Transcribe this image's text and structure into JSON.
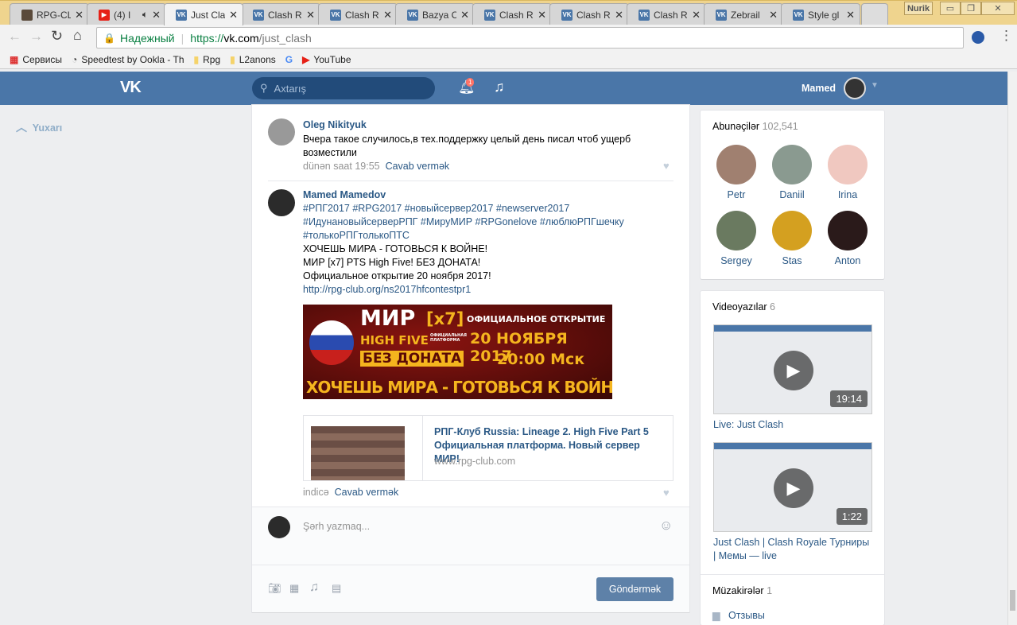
{
  "browser": {
    "tabs": [
      {
        "title": "RPG-CL",
        "icon": "rpg-favicon"
      },
      {
        "title": "(4) I",
        "icon": "youtube-favicon",
        "audio": true
      },
      {
        "title": "Just Cla",
        "icon": "vk-favicon",
        "active": true
      },
      {
        "title": "Clash R",
        "icon": "vk-favicon"
      },
      {
        "title": "Clash R",
        "icon": "vk-favicon"
      },
      {
        "title": "Bazya C",
        "icon": "vk-favicon"
      },
      {
        "title": "Clash R",
        "icon": "vk-favicon"
      },
      {
        "title": "Clash R",
        "icon": "vk-favicon"
      },
      {
        "title": "Clash R",
        "icon": "vk-favicon"
      },
      {
        "title": "Zebrail",
        "icon": "vk-favicon"
      },
      {
        "title": "Style gl",
        "icon": "vk-favicon"
      }
    ],
    "profile_label": "Nurik",
    "secure_label": "Надежный",
    "url_scheme": "https://",
    "url_host": "vk.com",
    "url_path": "/just_clash",
    "bookmarks": [
      {
        "label": "Сервисы",
        "icon": "apps-icon"
      },
      {
        "label": "Speedtest by Ookla - Th",
        "icon": "speedometer-icon"
      },
      {
        "label": "Rpg",
        "icon": "folder-icon"
      },
      {
        "label": "L2anons",
        "icon": "folder-icon"
      },
      {
        "label": "",
        "icon": "google-translate-icon"
      },
      {
        "label": "YouTube",
        "icon": "youtube-icon"
      }
    ]
  },
  "vk": {
    "search_placeholder": "Axtarış",
    "notifications_count": "1",
    "user_name": "Mamed",
    "back_to_top": "Yuxarı",
    "comments": [
      {
        "author": "Oleg Nikityuk",
        "text": "Вчера такое случилось,в тех.поддержку целый день писал чтоб ущерб возместили",
        "time": "dünən saat 19:55",
        "reply": "Cavab vermək"
      },
      {
        "author": "Mamed Mamedov",
        "hashtags": [
          "#РПГ2017 #RPG2017 #новыйсервер2017 #newserver2017",
          "#ИдунановыйсерверРПГ #МируМИР #RPGonelove #люблюРПГшечку",
          "#толькоРПГтолькоПТС"
        ],
        "lines": [
          "ХОЧЕШЬ МИРА - ГОТОВЬСЯ К ВОЙНЕ!",
          "МИР [x7] PTS High Five! БЕЗ ДОНАТА!",
          "Официальное открытие 20 ноября 2017!"
        ],
        "link": "http://rpg-club.org/ns2017hfcontestpr1",
        "banner": {
          "title": "МИР",
          "rate": "[x7]",
          "subtitle": "HIGH FIVE",
          "platform": "ОФИЦИАЛЬНАЯ ПЛАТФОРМА",
          "nodonate": "БЕЗ ДОНАТА",
          "opening": "ОФИЦИАЛЬНОЕ ОТКРЫТИЕ",
          "date": "20 НОЯБРЯ 2017",
          "time": "20:00 Мск",
          "slogan": "ХОЧЕШЬ МИРА - ГОТОВЬСЯ К ВОЙНЕ"
        },
        "snippet": {
          "title": "РПГ-Клуб Russia: Lineage 2. High Five Part 5 Официальная платформа. Новый сервер МИР!",
          "domain": "www.rpg-club.com"
        },
        "time": "indicə",
        "reply": "Cavab vermək"
      }
    ],
    "comment_placeholder": "Şərh yazmaq...",
    "send_label": "Göndərmək",
    "subscribers": {
      "label": "Abunəçilər",
      "count": "102,541",
      "people": [
        "Petr",
        "Daniil",
        "Irina",
        "Sergey",
        "Stas",
        "Anton"
      ]
    },
    "videos": {
      "label": "Videoyazılar",
      "count": "6",
      "items": [
        {
          "title": "Live: Just Clash",
          "duration": "19:14"
        },
        {
          "title": "Just Clash | Clash Royale Турниры | Мемы — live",
          "duration": "1:22"
        }
      ]
    },
    "discussions": {
      "label": "Müzakirələr",
      "count": "1",
      "items": [
        "Отзывы"
      ]
    }
  },
  "colors": {
    "vk_blue": "#4a76a8",
    "link": "#2a5885"
  }
}
